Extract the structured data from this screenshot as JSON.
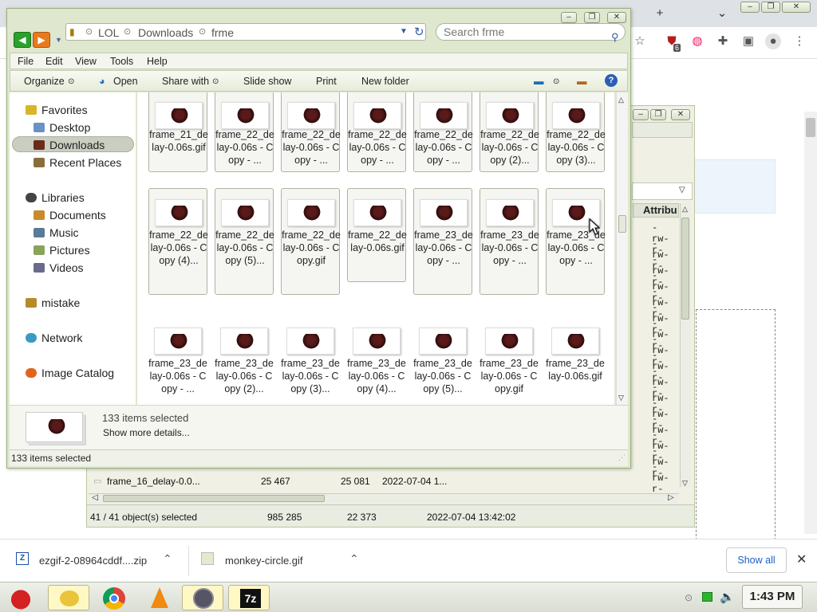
{
  "explorer": {
    "breadcrumb": [
      "LOL",
      "Downloads",
      "frme"
    ],
    "search_placeholder": "Search frme",
    "menu": [
      "File",
      "Edit",
      "View",
      "Tools",
      "Help"
    ],
    "commands": [
      "Organize",
      "Open",
      "Share with",
      "Slide show",
      "Print",
      "New folder"
    ],
    "nav": {
      "favorites": "Favorites",
      "desktop": "Desktop",
      "downloads": "Downloads",
      "recent": "Recent Places",
      "libraries": "Libraries",
      "documents": "Documents",
      "music": "Music",
      "pictures": "Pictures",
      "videos": "Videos",
      "mistake": "mistake",
      "network": "Network",
      "catalog": "Image Catalog"
    },
    "files": [
      [
        "frame_21_delay-0.06s.gif",
        "frame_22_delay-0.06s - Copy - ...",
        "frame_22_delay-0.06s - Copy - ...",
        "frame_22_delay-0.06s - Copy - ...",
        "frame_22_delay-0.06s - Copy - ...",
        "frame_22_delay-0.06s - Copy (2)...",
        "frame_22_delay-0.06s - Copy (3)..."
      ],
      [
        "frame_22_delay-0.06s - Copy (4)...",
        "frame_22_delay-0.06s - Copy (5)...",
        "frame_22_delay-0.06s - Copy.gif",
        "frame_22_delay-0.06s.gif",
        "frame_23_delay-0.06s - Copy - ...",
        "frame_23_delay-0.06s - Copy - ...",
        "frame_23_delay-0.06s - Copy - ..."
      ],
      [
        "frame_23_delay-0.06s - Copy - ...",
        "frame_23_delay-0.06s - Copy (2)...",
        "frame_23_delay-0.06s - Copy (3)...",
        "frame_23_delay-0.06s - Copy (4)...",
        "frame_23_delay-0.06s - Copy (5)...",
        "frame_23_delay-0.06s - Copy.gif",
        "frame_23_delay-0.06s.gif"
      ]
    ],
    "details_count": "133 items selected",
    "details_more": "Show more details...",
    "status": "133 items selected"
  },
  "filemanager": {
    "attr_header": "Attribu",
    "attr_value": "-rw-r-",
    "row_name": "frame_16_delay-0.0...",
    "row_size1": "25 467",
    "row_size2": "25 081",
    "row_date": "2022-07-04 1...",
    "status_objects": "41 / 41 object(s) selected",
    "status_size1": "985 285",
    "status_size2": "22 373",
    "status_date": "2022-07-04 13:42:02"
  },
  "downloads": {
    "item1": "ezgif-2-08964cddf....zip",
    "item2": "monkey-circle.gif",
    "show_all": "Show all"
  },
  "taskbar": {
    "clock": "1:43 PM"
  },
  "chrome": {
    "new_tab": "+",
    "badge": "6"
  }
}
